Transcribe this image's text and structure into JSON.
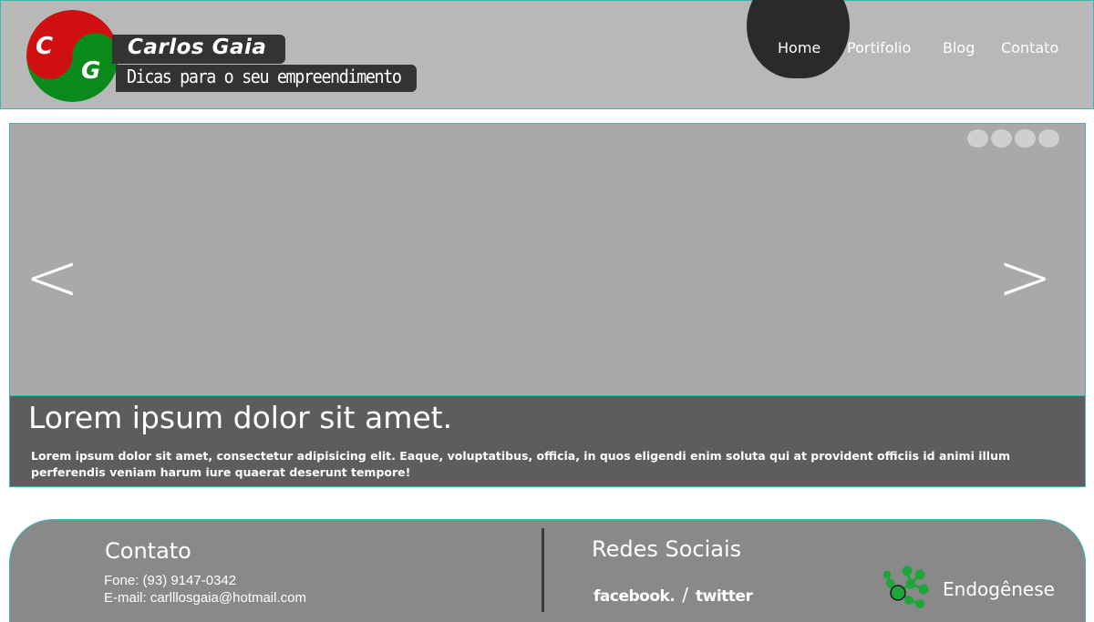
{
  "header": {
    "logo_letters": [
      "C",
      "G"
    ],
    "brand_name": "Carlos Gaia",
    "tagline": "Dicas para o seu empreendimento",
    "nav": [
      {
        "label": "Home",
        "active": true
      },
      {
        "label": "Portifolio",
        "active": false
      },
      {
        "label": "Blog",
        "active": false
      },
      {
        "label": "Contato",
        "active": false
      }
    ]
  },
  "slider": {
    "prev_label": "<",
    "next_label": ">",
    "dot_count": 4,
    "caption_title": "Lorem ipsum dolor sit amet.",
    "caption_text": "Lorem ipsum dolor sit amet, consectetur adipisicing elit. Eaque, voluptatibus, officia, in quos eligendi enim soluta qui at provident officiis id animi illum perferendis veniam harum iure quaerat deserunt tempore!"
  },
  "footer": {
    "contact_title": "Contato",
    "phone": "Fone: (93) 9147-0342",
    "email": "E-mail: carlllosgaia@hotmail.com",
    "social_title": "Redes Sociais",
    "facebook_label": "facebook.",
    "separator": "/",
    "twitter_label": "twitter",
    "partner_name": "Endogênese"
  },
  "colors": {
    "header_bg": "#b8b8b8",
    "accent_border": "#39b7b7",
    "slider_bg": "#a9a9a9",
    "caption_bg": "#5d5d5d",
    "footer_bg": "#898989",
    "logo_red": "#d01010",
    "logo_green": "#0a8a1a"
  }
}
